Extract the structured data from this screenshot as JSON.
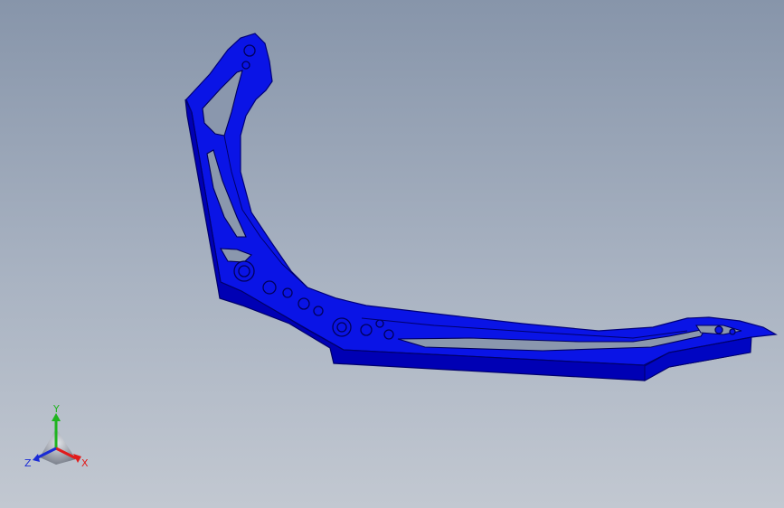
{
  "viewport": {
    "background_top": "#8795aa",
    "background_bottom": "#c2c8d1"
  },
  "part": {
    "color": "#0a14e6",
    "edge_color": "#00007a",
    "shadow_color": "#000066"
  },
  "triad": {
    "x_label": "X",
    "y_label": "Y",
    "z_label": "Z",
    "x_color": "#e21b1b",
    "y_color": "#1fb41f",
    "z_color": "#1a2bd6"
  }
}
